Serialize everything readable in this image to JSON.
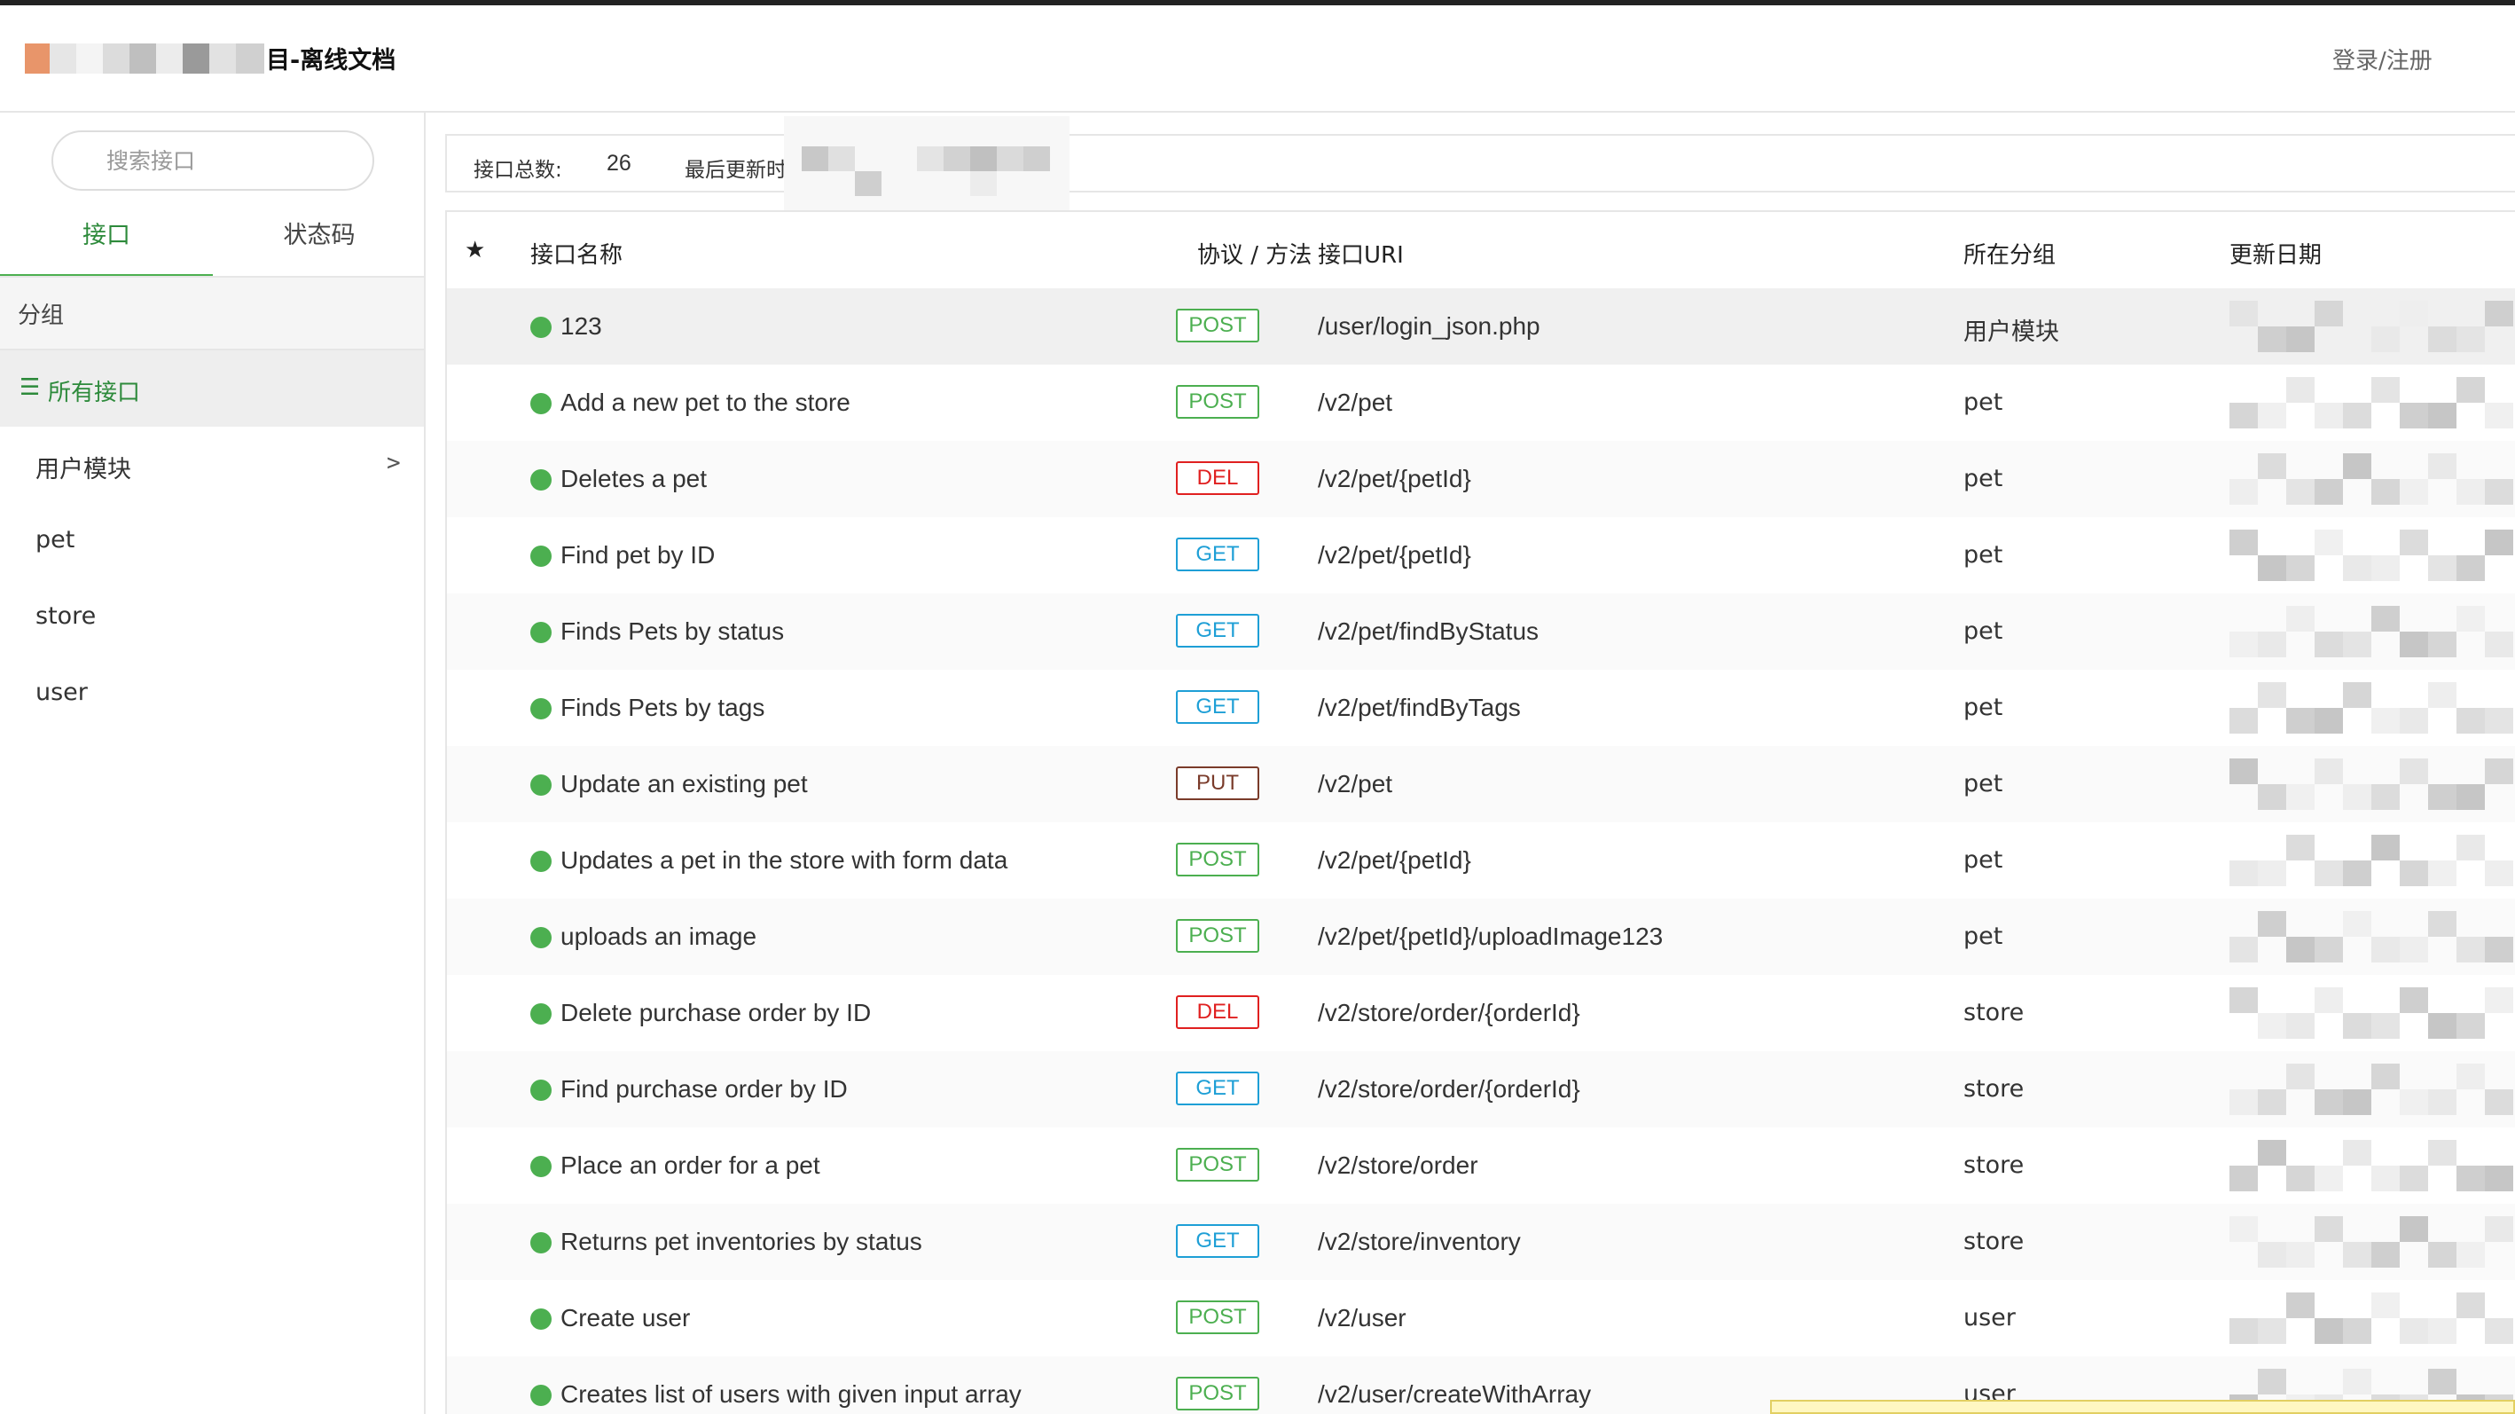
{
  "header": {
    "site_title": "目-离线文档",
    "login_label": "登录/注册"
  },
  "sidebar": {
    "search_placeholder": "搜索接口",
    "tabs": [
      {
        "label": "接口",
        "active": true
      },
      {
        "label": "状态码",
        "active": false
      }
    ],
    "group_header": "分组",
    "all_label": "所有接口",
    "all_icon": "menu-icon",
    "items": [
      {
        "label": "用户模块",
        "has_children": true,
        "chevron": ">"
      },
      {
        "label": "pet",
        "has_children": false
      },
      {
        "label": "store",
        "has_children": false
      },
      {
        "label": "user",
        "has_children": false
      }
    ]
  },
  "summary": {
    "total_label": "接口总数:",
    "total_value": "26",
    "updated_label": "最后更新时间"
  },
  "table": {
    "columns": {
      "star": "★",
      "name": "接口名称",
      "method": "协议 / 方法",
      "uri": "接口URI",
      "group": "所在分组",
      "date": "更新日期"
    },
    "rows": [
      {
        "name": "123",
        "method": "POST",
        "uri": "/user/login_json.php",
        "group": "用户模块"
      },
      {
        "name": "Add a new pet to the store",
        "method": "POST",
        "uri": "/v2/pet",
        "group": "pet"
      },
      {
        "name": "Deletes a pet",
        "method": "DEL",
        "uri": "/v2/pet/{petId}",
        "group": "pet"
      },
      {
        "name": "Find pet by ID",
        "method": "GET",
        "uri": "/v2/pet/{petId}",
        "group": "pet"
      },
      {
        "name": "Finds Pets by status",
        "method": "GET",
        "uri": "/v2/pet/findByStatus",
        "group": "pet"
      },
      {
        "name": "Finds Pets by tags",
        "method": "GET",
        "uri": "/v2/pet/findByTags",
        "group": "pet"
      },
      {
        "name": "Update an existing pet",
        "method": "PUT",
        "uri": "/v2/pet",
        "group": "pet"
      },
      {
        "name": "Updates a pet in the store with form data",
        "method": "POST",
        "uri": "/v2/pet/{petId}",
        "group": "pet"
      },
      {
        "name": "uploads an image",
        "method": "POST",
        "uri": "/v2/pet/{petId}/uploadImage123",
        "group": "pet"
      },
      {
        "name": "Delete purchase order by ID",
        "method": "DEL",
        "uri": "/v2/store/order/{orderId}",
        "group": "store"
      },
      {
        "name": "Find purchase order by ID",
        "method": "GET",
        "uri": "/v2/store/order/{orderId}",
        "group": "store"
      },
      {
        "name": "Place an order for a pet",
        "method": "POST",
        "uri": "/v2/store/order",
        "group": "store"
      },
      {
        "name": "Returns pet inventories by status",
        "method": "GET",
        "uri": "/v2/store/inventory",
        "group": "store"
      },
      {
        "name": "Create user",
        "method": "POST",
        "uri": "/v2/user",
        "group": "user"
      },
      {
        "name": "Creates list of users with given input array",
        "method": "POST",
        "uri": "/v2/user/createWithArray",
        "group": "user"
      }
    ]
  },
  "colors": {
    "accent": "#4caf50",
    "status_dot": "#4caf50",
    "POST": "#4caf50",
    "GET": "#1e9fd6",
    "DEL": "#e02020",
    "PUT": "#7a3b2a",
    "logo_orange": "#e8956a"
  }
}
